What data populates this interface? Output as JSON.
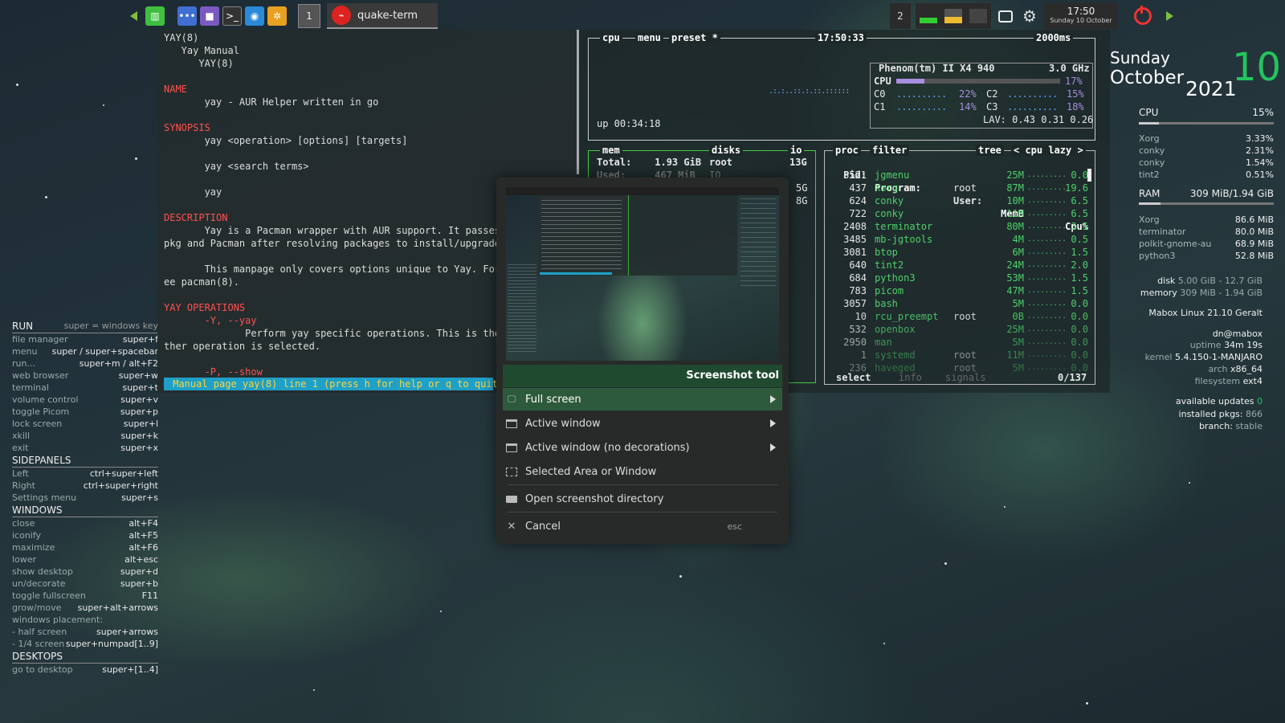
{
  "top_panel": {
    "desktop_number": "1",
    "task_title": "quake-term",
    "workspace_count": "2",
    "clock_time": "17:50",
    "clock_date": "Sunday 10 October"
  },
  "man": {
    "lines": [
      {
        "t": "YAY(8)",
        "c": ""
      },
      {
        "t": "   Yay Manual",
        "c": ""
      },
      {
        "t": "      YAY(8)",
        "c": ""
      },
      {
        "t": "",
        "c": ""
      },
      {
        "t": "NAME",
        "c": "r"
      },
      {
        "t": "       yay - AUR Helper written in go",
        "c": ""
      },
      {
        "t": "",
        "c": ""
      },
      {
        "t": "SYNOPSIS",
        "c": "r"
      },
      {
        "t": "       yay <operation> [options] [targets]",
        "c": ""
      },
      {
        "t": "",
        "c": ""
      },
      {
        "t": "       yay <search terms>",
        "c": ""
      },
      {
        "t": "",
        "c": ""
      },
      {
        "t": "       yay",
        "c": ""
      },
      {
        "t": "",
        "c": ""
      },
      {
        "t": "DESCRIPTION",
        "c": "r"
      },
      {
        "t": "       Yay is a Pacman wrapper with AUR support. It passes",
        "c": ""
      },
      {
        "t": "pkg and Pacman after resolving packages to install/upgrade.",
        "c": ""
      },
      {
        "t": "",
        "c": ""
      },
      {
        "t": "       This manpage only covers options unique to Yay. For",
        "c": ""
      },
      {
        "t": "ee pacman(8).",
        "c": ""
      },
      {
        "t": "",
        "c": ""
      },
      {
        "t": "YAY OPERATIONS",
        "c": "r"
      },
      {
        "t": "       -Y, --yay",
        "c": "r"
      },
      {
        "t": "              Perform yay specific operations. This is the",
        "c": ""
      },
      {
        "t": "ther operation is selected.",
        "c": ""
      },
      {
        "t": "",
        "c": ""
      },
      {
        "t": "       -P, --show",
        "c": "r"
      }
    ],
    "status": " Manual page yay(8) line 1 (press h for help or q to quit)"
  },
  "btop": {
    "cpu_title": "cpu",
    "menu_title": "menu",
    "preset_title": "preset *",
    "time": "17:50:33",
    "interval": "2000ms",
    "cpu_model": "Phenom(tm) II X4 940",
    "freq": "3.0 GHz",
    "cpu_label": "CPU",
    "cpu_total": "17%",
    "cores": [
      {
        "name": "C0",
        "pct": "22%"
      },
      {
        "name": "C2",
        "pct": "15%"
      },
      {
        "name": "C1",
        "pct": "14%"
      },
      {
        "name": "C3",
        "pct": "18%"
      }
    ],
    "lav": "LAV: 0.43 0.31 0.26",
    "uptime": "up 00:34:18",
    "mem_title": "mem",
    "disks_title": "disks",
    "io_title": "io",
    "mem_total": "Total:    1.93 GiB",
    "mem_used": "Used:     467 MiB",
    "disk_root": "root",
    "disk_root_size": "13G",
    "disk_io": "IO",
    "disk_5g": "5G",
    "disk_8g": "8G",
    "proc_title": "proc",
    "filter_title": "filter",
    "tree_title": "tree",
    "cpu_lazy": "< cpu lazy >",
    "headers": {
      "pid": "Pid:",
      "program": "Program:",
      "user": "User:",
      "mem": "MemB",
      "cpu": "Cpu%"
    },
    "processes": [
      {
        "pid": "3521",
        "prog": "jgmenu",
        "user": "",
        "mem": "25M",
        "cpu": "0.0"
      },
      {
        "pid": "437",
        "prog": "Xorg",
        "user": "root",
        "mem": "87M",
        "cpu": "19.6"
      },
      {
        "pid": "624",
        "prog": "conky",
        "user": "",
        "mem": "10M",
        "cpu": "6.5"
      },
      {
        "pid": "722",
        "prog": "conky",
        "user": "",
        "mem": "11M",
        "cpu": "6.5"
      },
      {
        "pid": "2408",
        "prog": "terminator",
        "user": "",
        "mem": "80M",
        "cpu": "3.5"
      },
      {
        "pid": "3485",
        "prog": "mb-jgtools",
        "user": "",
        "mem": "4M",
        "cpu": "0.5"
      },
      {
        "pid": "3081",
        "prog": "btop",
        "user": "",
        "mem": "6M",
        "cpu": "1.5"
      },
      {
        "pid": "640",
        "prog": "tint2",
        "user": "",
        "mem": "24M",
        "cpu": "2.0"
      },
      {
        "pid": "684",
        "prog": "python3",
        "user": "",
        "mem": "53M",
        "cpu": "1.5"
      },
      {
        "pid": "783",
        "prog": "picom",
        "user": "",
        "mem": "47M",
        "cpu": "1.5"
      },
      {
        "pid": "3057",
        "prog": "bash",
        "user": "",
        "mem": "5M",
        "cpu": "0.0"
      },
      {
        "pid": "10",
        "prog": "rcu_preempt",
        "user": "root",
        "mem": "0B",
        "cpu": "0.0"
      },
      {
        "pid": "532",
        "prog": "openbox",
        "user": "",
        "mem": "25M",
        "cpu": "0.0"
      },
      {
        "pid": "2950",
        "prog": "man",
        "user": "",
        "mem": "5M",
        "cpu": "0.0"
      },
      {
        "pid": "1",
        "prog": "systemd",
        "user": "root",
        "mem": "11M",
        "cpu": "0.0"
      },
      {
        "pid": "236",
        "prog": "haveged",
        "user": "root",
        "mem": "5M",
        "cpu": "0.0"
      }
    ],
    "select_label": "select",
    "info_label": "info",
    "signals_label": "signals",
    "count": "0/137"
  },
  "dialog": {
    "title": "Screenshot tool",
    "items": [
      {
        "label": "Full screen"
      },
      {
        "label": "Active window"
      },
      {
        "label": "Active window (no decorations)"
      },
      {
        "label": "Selected Area or Window"
      },
      {
        "label": "Open screenshot directory"
      },
      {
        "label": "Cancel",
        "shortcut": "esc"
      }
    ]
  },
  "keys": {
    "run": {
      "title": "RUN",
      "hint": "super = windows key",
      "rows": [
        {
          "d": "file manager",
          "k": "super+f"
        },
        {
          "d": "menu",
          "k": "super / super+spacebar"
        },
        {
          "d": "run...",
          "k": "super+m / alt+F2"
        },
        {
          "d": "web browser",
          "k": "super+w"
        },
        {
          "d": "terminal",
          "k": "super+t"
        },
        {
          "d": "volume control",
          "k": "super+v"
        },
        {
          "d": "toggle Picom",
          "k": "super+p"
        },
        {
          "d": "lock screen",
          "k": "super+l"
        },
        {
          "d": "xkill",
          "k": "super+k"
        },
        {
          "d": "exit",
          "k": "super+x"
        }
      ]
    },
    "sidepanels": {
      "title": "SIDEPANELS",
      "rows": [
        {
          "d": "Left",
          "k": "ctrl+super+left"
        },
        {
          "d": "Right",
          "k": "ctrl+super+right"
        },
        {
          "d": "Settings menu",
          "k": "super+s"
        }
      ]
    },
    "windows": {
      "title": "WINDOWS",
      "rows": [
        {
          "d": "close",
          "k": "alt+F4"
        },
        {
          "d": "iconify",
          "k": "alt+F5"
        },
        {
          "d": "maximize",
          "k": "alt+F6"
        },
        {
          "d": "lower",
          "k": "alt+esc"
        },
        {
          "d": "show desktop",
          "k": "super+d"
        },
        {
          "d": "un/decorate",
          "k": "super+b"
        },
        {
          "d": "toggle fullscreen",
          "k": "F11"
        },
        {
          "d": "grow/move",
          "k": "super+alt+arrows"
        },
        {
          "d": "windows placement:",
          "k": ""
        },
        {
          "d": " - half screen",
          "k": "super+arrows"
        },
        {
          "d": " - 1/4 screen",
          "k": "super+numpad[1..9]"
        }
      ]
    },
    "desktops": {
      "title": "DESKTOPS",
      "rows": [
        {
          "d": "go to desktop",
          "k": "super+[1..4]"
        }
      ]
    }
  },
  "conky": {
    "day": "Sunday",
    "month": "October",
    "year": "2021",
    "daynum": "10",
    "cpu_label": "CPU",
    "cpu_pct": "15%",
    "cpu_fraction": 0.15,
    "cpu_procs": [
      {
        "n": "Xorg",
        "v": "3.33%"
      },
      {
        "n": "conky",
        "v": "2.31%"
      },
      {
        "n": "conky",
        "v": "1.54%"
      },
      {
        "n": "tint2",
        "v": "0.51%"
      }
    ],
    "ram_label": "RAM",
    "ram_val": "309 MiB/1.94 GiB",
    "ram_fraction": 0.16,
    "ram_procs": [
      {
        "n": "Xorg",
        "v": "86.6 MiB"
      },
      {
        "n": "terminator",
        "v": "80.0 MiB"
      },
      {
        "n": "polkit-gnome-au",
        "v": "68.9 MiB"
      },
      {
        "n": "python3",
        "v": "52.8 MiB"
      }
    ],
    "disk_label": "disk",
    "disk_val": "5.00 GiB - 12.7 GiB",
    "memory_label": "memory",
    "memory_val": "309 MiB - 1.94 GiB",
    "distro": "Mabox Linux 21.10 Geralt",
    "user": "dn@mabox",
    "uptime_label": "uptime",
    "uptime_val": "34m 19s",
    "kernel_label": "kernel",
    "kernel_val": "5.4.150-1-MANJARO",
    "arch_label": "arch",
    "arch_val": "x86_64",
    "fs_label": "filesystem",
    "fs_val": "ext4",
    "updates_label": "available updates",
    "updates_val": "0",
    "pkgs_label": "installed pkgs:",
    "pkgs_val": "866",
    "branch_label": "branch:",
    "branch_val": "stable"
  }
}
